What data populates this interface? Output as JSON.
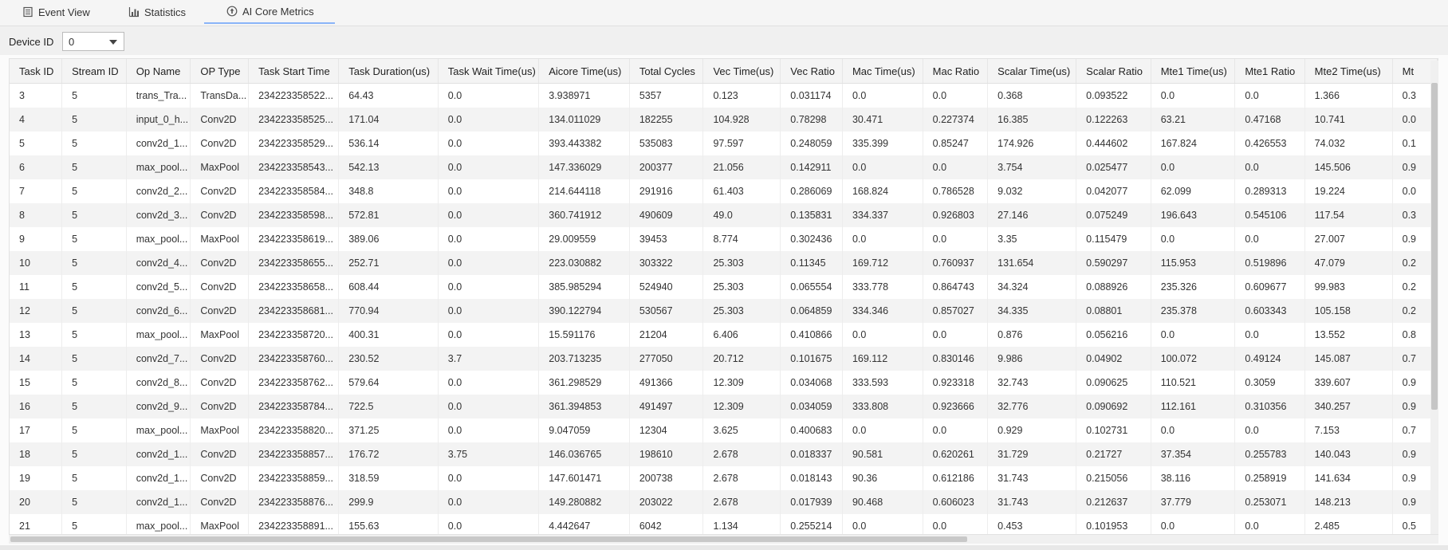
{
  "tabs": [
    {
      "label": "Event View",
      "icon": "document-icon",
      "active": false
    },
    {
      "label": "Statistics",
      "icon": "bar-chart-icon",
      "active": false
    },
    {
      "label": "AI Core Metrics",
      "icon": "upload-circle-icon",
      "active": true
    }
  ],
  "device": {
    "label": "Device ID",
    "value": "0"
  },
  "table": {
    "columns": [
      "Task ID",
      "Stream ID",
      "Op Name",
      "OP Type",
      "Task Start Time",
      "Task Duration(us)",
      "Task Wait Time(us)",
      "Aicore Time(us)",
      "Total Cycles",
      "Vec Time(us)",
      "Vec Ratio",
      "Mac Time(us)",
      "Mac Ratio",
      "Scalar Time(us)",
      "Scalar Ratio",
      "Mte1 Time(us)",
      "Mte1 Ratio",
      "Mte2 Time(us)",
      "Mt"
    ],
    "rows": [
      [
        "3",
        "5",
        "trans_Tra...",
        "TransDa...",
        "234223358522...",
        "64.43",
        "0.0",
        "3.938971",
        "5357",
        "0.123",
        "0.031174",
        "0.0",
        "0.0",
        "0.368",
        "0.093522",
        "0.0",
        "0.0",
        "1.366",
        "0.3"
      ],
      [
        "4",
        "5",
        "input_0_h...",
        "Conv2D",
        "234223358525...",
        "171.04",
        "0.0",
        "134.011029",
        "182255",
        "104.928",
        "0.78298",
        "30.471",
        "0.227374",
        "16.385",
        "0.122263",
        "63.21",
        "0.47168",
        "10.741",
        "0.0"
      ],
      [
        "5",
        "5",
        "conv2d_1...",
        "Conv2D",
        "234223358529...",
        "536.14",
        "0.0",
        "393.443382",
        "535083",
        "97.597",
        "0.248059",
        "335.399",
        "0.85247",
        "174.926",
        "0.444602",
        "167.824",
        "0.426553",
        "74.032",
        "0.1"
      ],
      [
        "6",
        "5",
        "max_pool...",
        "MaxPool",
        "234223358543...",
        "542.13",
        "0.0",
        "147.336029",
        "200377",
        "21.056",
        "0.142911",
        "0.0",
        "0.0",
        "3.754",
        "0.025477",
        "0.0",
        "0.0",
        "145.506",
        "0.9"
      ],
      [
        "7",
        "5",
        "conv2d_2...",
        "Conv2D",
        "234223358584...",
        "348.8",
        "0.0",
        "214.644118",
        "291916",
        "61.403",
        "0.286069",
        "168.824",
        "0.786528",
        "9.032",
        "0.042077",
        "62.099",
        "0.289313",
        "19.224",
        "0.0"
      ],
      [
        "8",
        "5",
        "conv2d_3...",
        "Conv2D",
        "234223358598...",
        "572.81",
        "0.0",
        "360.741912",
        "490609",
        "49.0",
        "0.135831",
        "334.337",
        "0.926803",
        "27.146",
        "0.075249",
        "196.643",
        "0.545106",
        "117.54",
        "0.3"
      ],
      [
        "9",
        "5",
        "max_pool...",
        "MaxPool",
        "234223358619...",
        "389.06",
        "0.0",
        "29.009559",
        "39453",
        "8.774",
        "0.302436",
        "0.0",
        "0.0",
        "3.35",
        "0.115479",
        "0.0",
        "0.0",
        "27.007",
        "0.9"
      ],
      [
        "10",
        "5",
        "conv2d_4...",
        "Conv2D",
        "234223358655...",
        "252.71",
        "0.0",
        "223.030882",
        "303322",
        "25.303",
        "0.11345",
        "169.712",
        "0.760937",
        "131.654",
        "0.590297",
        "115.953",
        "0.519896",
        "47.079",
        "0.2"
      ],
      [
        "11",
        "5",
        "conv2d_5...",
        "Conv2D",
        "234223358658...",
        "608.44",
        "0.0",
        "385.985294",
        "524940",
        "25.303",
        "0.065554",
        "333.778",
        "0.864743",
        "34.324",
        "0.088926",
        "235.326",
        "0.609677",
        "99.983",
        "0.2"
      ],
      [
        "12",
        "5",
        "conv2d_6...",
        "Conv2D",
        "234223358681...",
        "770.94",
        "0.0",
        "390.122794",
        "530567",
        "25.303",
        "0.064859",
        "334.346",
        "0.857027",
        "34.335",
        "0.08801",
        "235.378",
        "0.603343",
        "105.158",
        "0.2"
      ],
      [
        "13",
        "5",
        "max_pool...",
        "MaxPool",
        "234223358720...",
        "400.31",
        "0.0",
        "15.591176",
        "21204",
        "6.406",
        "0.410866",
        "0.0",
        "0.0",
        "0.876",
        "0.056216",
        "0.0",
        "0.0",
        "13.552",
        "0.8"
      ],
      [
        "14",
        "5",
        "conv2d_7...",
        "Conv2D",
        "234223358760...",
        "230.52",
        "3.7",
        "203.713235",
        "277050",
        "20.712",
        "0.101675",
        "169.112",
        "0.830146",
        "9.986",
        "0.04902",
        "100.072",
        "0.49124",
        "145.087",
        "0.7"
      ],
      [
        "15",
        "5",
        "conv2d_8...",
        "Conv2D",
        "234223358762...",
        "579.64",
        "0.0",
        "361.298529",
        "491366",
        "12.309",
        "0.034068",
        "333.593",
        "0.923318",
        "32.743",
        "0.090625",
        "110.521",
        "0.3059",
        "339.607",
        "0.9"
      ],
      [
        "16",
        "5",
        "conv2d_9...",
        "Conv2D",
        "234223358784...",
        "722.5",
        "0.0",
        "361.394853",
        "491497",
        "12.309",
        "0.034059",
        "333.808",
        "0.923666",
        "32.776",
        "0.090692",
        "112.161",
        "0.310356",
        "340.257",
        "0.9"
      ],
      [
        "17",
        "5",
        "max_pool...",
        "MaxPool",
        "234223358820...",
        "371.25",
        "0.0",
        "9.047059",
        "12304",
        "3.625",
        "0.400683",
        "0.0",
        "0.0",
        "0.929",
        "0.102731",
        "0.0",
        "0.0",
        "7.153",
        "0.7"
      ],
      [
        "18",
        "5",
        "conv2d_1...",
        "Conv2D",
        "234223358857...",
        "176.72",
        "3.75",
        "146.036765",
        "198610",
        "2.678",
        "0.018337",
        "90.581",
        "0.620261",
        "31.729",
        "0.21727",
        "37.354",
        "0.255783",
        "140.043",
        "0.9"
      ],
      [
        "19",
        "5",
        "conv2d_1...",
        "Conv2D",
        "234223358859...",
        "318.59",
        "0.0",
        "147.601471",
        "200738",
        "2.678",
        "0.018143",
        "90.36",
        "0.612186",
        "31.743",
        "0.215056",
        "38.116",
        "0.258919",
        "141.634",
        "0.9"
      ],
      [
        "20",
        "5",
        "conv2d_1...",
        "Conv2D",
        "234223358876...",
        "299.9",
        "0.0",
        "149.280882",
        "203022",
        "2.678",
        "0.017939",
        "90.468",
        "0.606023",
        "31.743",
        "0.212637",
        "37.779",
        "0.253071",
        "148.213",
        "0.9"
      ],
      [
        "21",
        "5",
        "max_pool...",
        "MaxPool",
        "234223358891...",
        "155.63",
        "0.0",
        "4.442647",
        "6042",
        "1.134",
        "0.255214",
        "0.0",
        "0.0",
        "0.453",
        "0.101953",
        "0.0",
        "0.0",
        "2.485",
        "0.5"
      ]
    ]
  }
}
